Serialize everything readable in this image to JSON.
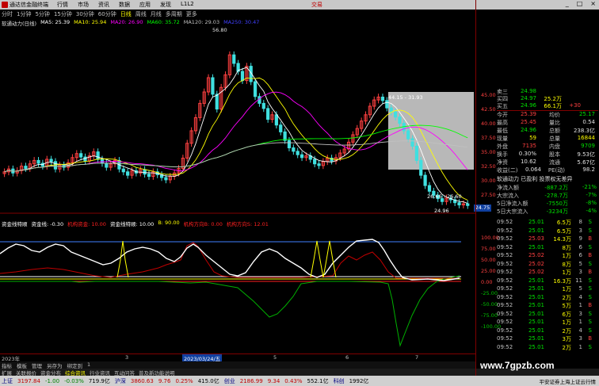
{
  "menubar": {
    "app_name": "通达信金融终端",
    "menus": [
      "行情",
      "市场",
      "资讯",
      "数据",
      "应用",
      "发现",
      "L1L2",
      "",
      "",
      "",
      "",
      "",
      "交易"
    ],
    "trade_label": "交易"
  },
  "periods": [
    "分时",
    "1分钟",
    "5分钟",
    "15分钟",
    "30分钟",
    "60分钟",
    "日线",
    "周线",
    "月线",
    "多周期",
    "更多"
  ],
  "active_period": "日线",
  "ma_bar": {
    "title": "软通动力(日线)",
    "ma5": "MA5: 25.39",
    "ma10": "MA10: 25.94",
    "ma20": "MA20: 26.90",
    "ma60": "MA60: 35.72",
    "ma120": "MA120: 29.03",
    "ma250": "MA250: 30.47"
  },
  "main_chart": {
    "high_label": "56.80",
    "range_label": "44.15 - 31.93",
    "level_label_1": "26.66 - 26.60",
    "low_label": "24.96",
    "price_tag": "24.75"
  },
  "right_scale": [
    "45.00",
    "42.50",
    "40.00",
    "37.50",
    "35.00",
    "32.50",
    "30.00",
    "27.50",
    "25.00"
  ],
  "sub_scale": [
    "100.00",
    "75.00",
    "50.00",
    "25.00",
    "0.00",
    "-25.00",
    "-50.00",
    "-75.00",
    "-100.00"
  ],
  "indicator_bar": {
    "name": "资金线特顺",
    "label1": "资金线: -0.30",
    "label2": "机构资金: 10.00",
    "label3": "资金线特顺: 10.00",
    "label4": "B: 90.00",
    "label5": "机构方向B: 0.00",
    "label6": "机构方向S: 12.01"
  },
  "quotes": [
    {
      "c1": "卖三",
      "c2": "24.98",
      "c3": "",
      "c4": "",
      "c5": ""
    },
    {
      "c1": "买四",
      "c2": "24.97",
      "c3": "25.2万",
      "c4": "",
      "c5": ""
    },
    {
      "c1": "买五",
      "c2": "24.96",
      "c3": "66.1万",
      "c4": "",
      "c5": "+30"
    }
  ],
  "stats": [
    {
      "k1": "今开",
      "v1": "25.39",
      "k2": "均价",
      "v2": "25.17"
    },
    {
      "k1": "最高",
      "v1": "25.45",
      "k2": "量比",
      "v2": "0.54"
    },
    {
      "k1": "最低",
      "v1": "24.96",
      "k2": "总额",
      "v2": "238.3亿"
    },
    {
      "k1": "现量",
      "v1": "59",
      "k2": "总量",
      "v2": "16844"
    },
    {
      "k1": "外盘",
      "v1": "7135",
      "k2": "内盘",
      "v2": "9709"
    },
    {
      "k1": "换手",
      "v1": "0.30%",
      "k2": "股本",
      "v2": "9.53亿"
    },
    {
      "k1": "净资",
      "v1": "10.62",
      "k2": "流通",
      "v2": "5.67亿"
    },
    {
      "k1": "收益(二)",
      "v1": "0.064",
      "k2": "PE(动)",
      "v2": "98.2"
    }
  ],
  "info_line": "软通动力 已盈利 投票权无差异",
  "flows": [
    {
      "k": "净流入额",
      "v": "-887.2万",
      "pct": "-21%"
    },
    {
      "k": "大宗流入",
      "v": "-278.7万",
      "pct": "-7%"
    },
    {
      "k": "5日净流入额",
      "v": "-7550万",
      "pct": "-8%"
    },
    {
      "k": "5日大宗流入",
      "v": "-3234万",
      "pct": "-4%"
    }
  ],
  "ticks": [
    {
      "t": "09:52",
      "p": "25.01",
      "v": "6.5万",
      "n": "8",
      "bs": "S"
    },
    {
      "t": "09:52",
      "p": "25.01",
      "v": "6.5万",
      "n": "3",
      "bs": "S"
    },
    {
      "t": "09:52",
      "p": "25.03",
      "v": "14.3万",
      "n": "9",
      "bs": "B"
    },
    {
      "t": "09:52",
      "p": "25.01",
      "v": "8万",
      "n": "6",
      "bs": "S"
    },
    {
      "t": "09:52",
      "p": "25.02",
      "v": "1万",
      "n": "6",
      "bs": "B"
    },
    {
      "t": "09:52",
      "p": "25.02",
      "v": "8万",
      "n": "5",
      "bs": "S"
    },
    {
      "t": "09:52",
      "p": "25.02",
      "v": "1万",
      "n": "3",
      "bs": "B"
    },
    {
      "t": "09:52",
      "p": "25.01",
      "v": "16.3万",
      "n": "11",
      "bs": "S"
    },
    {
      "t": "09:52",
      "p": "25.01",
      "v": "1万",
      "n": "5",
      "bs": "S"
    },
    {
      "t": "09:52",
      "p": "25.01",
      "v": "2万",
      "n": "4",
      "bs": "S"
    },
    {
      "t": "09:52",
      "p": "25.01",
      "v": "5万",
      "n": "1",
      "bs": "B"
    },
    {
      "t": "09:52",
      "p": "25.01",
      "v": "6万",
      "n": "3",
      "bs": "S"
    },
    {
      "t": "09:52",
      "p": "25.01",
      "v": "1万",
      "n": "1",
      "bs": "S"
    },
    {
      "t": "09:52",
      "p": "25.01",
      "v": "2万",
      "n": "4",
      "bs": "S"
    },
    {
      "t": "09:52",
      "p": "25.01",
      "v": "3万",
      "n": "3",
      "bs": "B"
    },
    {
      "t": "09:52",
      "p": "25.01",
      "v": "2万",
      "n": "1",
      "bs": "S"
    }
  ],
  "date_labels": [
    "2023年",
    "3",
    "2023/03/24/五",
    "5",
    "6",
    "7"
  ],
  "tabs1": [
    "指标",
    "模板",
    "管理",
    "另存为",
    "绑定到",
    "1"
  ],
  "tabs2": [
    "扩展",
    "关联报价",
    "资金分布",
    "综合资讯",
    "行业资讯",
    "互动问答",
    "普及新功能说明"
  ],
  "status": {
    "sh_name": "上证",
    "sh_val": "3197.84",
    "sh_chg": "-1.00",
    "sh_pct": "-0.03%",
    "sh_amt": "719.9亿",
    "sz_name": "沪深",
    "sz_val": "3860.63",
    "sz_chg": "9.76",
    "sz_pct": "0.25%",
    "sz_amt": "415.0亿",
    "cy_name": "创业",
    "cy_val": "2186.99",
    "cy_chg": "9.34",
    "cy_pct": "0.43%",
    "cy_amt": "552.1亿",
    "k_name": "科创",
    "k_val": "1992亿",
    "right": "平安证券上海上证云行情"
  },
  "watermark": "www.7gpzb.com",
  "colors": {
    "up": "#ff4040",
    "down": "#40e0e0",
    "ma5": "#ffffff",
    "ma10": "#ffff00",
    "ma20": "#ff00ff",
    "ma60": "#00ff00",
    "ma120": "#c0c0c0",
    "ma250": "#4040ff"
  }
}
